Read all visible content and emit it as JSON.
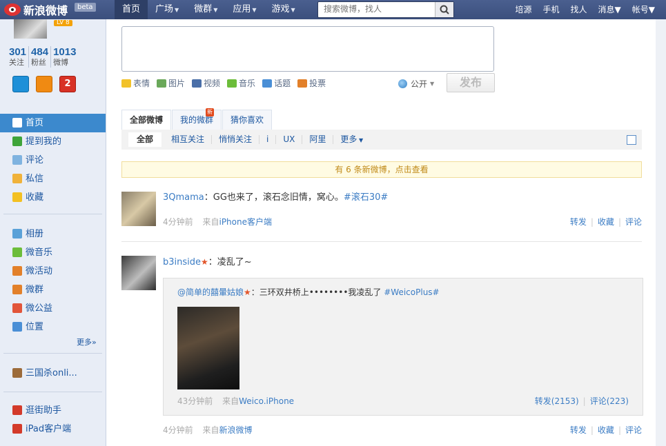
{
  "topbar": {
    "logo": "新浪微博",
    "beta": "beta",
    "nav": [
      {
        "label": "首页",
        "caret": false,
        "active": true
      },
      {
        "label": "广场",
        "caret": true
      },
      {
        "label": "微群",
        "caret": true
      },
      {
        "label": "应用",
        "caret": true
      },
      {
        "label": "游戏",
        "caret": true
      }
    ],
    "search_placeholder": "搜索微博，找人",
    "right_nav": [
      {
        "label": "培源",
        "caret": false
      },
      {
        "label": "手机",
        "caret": false
      },
      {
        "label": "找人",
        "caret": false
      },
      {
        "label": "消息",
        "caret": true
      },
      {
        "label": "帐号",
        "caret": true
      }
    ]
  },
  "profile": {
    "level": "LV 8",
    "stats": [
      {
        "count": "301",
        "label": "关注"
      },
      {
        "count": "484",
        "label": "粉丝"
      },
      {
        "count": "1013",
        "label": "微博"
      }
    ],
    "badge_text": "2"
  },
  "sidebar": {
    "main_items": [
      {
        "label": "首页",
        "icon": "home-icon",
        "color": "#ffffff",
        "active": true
      },
      {
        "label": "提到我的",
        "icon": "at-icon",
        "color": "#3ea43a"
      },
      {
        "label": "评论",
        "icon": "comment-icon",
        "color": "#7fb3e0"
      },
      {
        "label": "私信",
        "icon": "mail-icon",
        "color": "#f0b23a"
      },
      {
        "label": "收藏",
        "icon": "star-icon",
        "color": "#f3c022"
      }
    ],
    "app_items": [
      {
        "label": "相册",
        "icon": "album-icon",
        "color": "#5aa1d8"
      },
      {
        "label": "微音乐",
        "icon": "music-icon",
        "color": "#6cbd3a"
      },
      {
        "label": "微活动",
        "icon": "event-icon",
        "color": "#e2802a"
      },
      {
        "label": "微群",
        "icon": "group-icon",
        "color": "#e2802a"
      },
      {
        "label": "微公益",
        "icon": "charity-icon",
        "color": "#e2553a"
      },
      {
        "label": "位置",
        "icon": "location-icon",
        "color": "#4a8fd6"
      }
    ],
    "more": "更多»",
    "game_items": [
      {
        "label": "三国杀onli...",
        "icon": "game-icon",
        "color": "#9c6b3a"
      }
    ],
    "tool_items": [
      {
        "label": "逛街助手",
        "icon": "shop-icon",
        "color": "#d33a2a"
      },
      {
        "label": "iPad客户端",
        "icon": "weibo-icon",
        "color": "#d33a2a"
      }
    ]
  },
  "composer": {
    "tools": [
      {
        "label": "表情",
        "icon": "smiley-icon",
        "color": "#f2c22a"
      },
      {
        "label": "图片",
        "icon": "image-icon",
        "color": "#6aa85a"
      },
      {
        "label": "视频",
        "icon": "video-icon",
        "color": "#4a6fa8"
      },
      {
        "label": "音乐",
        "icon": "music-icon",
        "color": "#6cbd3a"
      },
      {
        "label": "话题",
        "icon": "topic-icon",
        "color": "#4a8fd6"
      },
      {
        "label": "投票",
        "icon": "vote-icon",
        "color": "#e2802a"
      }
    ],
    "visibility": "公开",
    "post_button": "发布"
  },
  "tabs": [
    {
      "label": "全部微博",
      "active": true
    },
    {
      "label": "我的微群",
      "new_tag": "新"
    },
    {
      "label": "猜你喜欢"
    }
  ],
  "subtabs": [
    "全部",
    "相互关注",
    "悄悄关注",
    "i",
    "UX",
    "阿里",
    "更多"
  ],
  "notice": "有 6 条新微博，点击查看",
  "feed": [
    {
      "user": "3Qmama",
      "text": "：GG也来了，滚石念旧情，窝心。",
      "topic": "#滚石30#",
      "time": "4分钟前",
      "from": "来自",
      "source": "iPhone客户端",
      "repost": "转发",
      "fav": "收藏",
      "comment": "评论"
    },
    {
      "user": "b3inside",
      "text": "：凌乱了~",
      "time": "4分钟前",
      "from": "来自",
      "source": "新浪微博",
      "repost": "转发",
      "fav": "收藏",
      "comment": "评论",
      "quoted": {
        "user": "@简单的囍暈姑娘",
        "text": "：三环双井桥上••••••••我凌乱了",
        "topic": "#WeicoPlus#",
        "time": "43分钟前",
        "from": "来自",
        "source": "Weico.iPhone",
        "repost": "转发(2153)",
        "comment": "评论(223)"
      }
    }
  ]
}
